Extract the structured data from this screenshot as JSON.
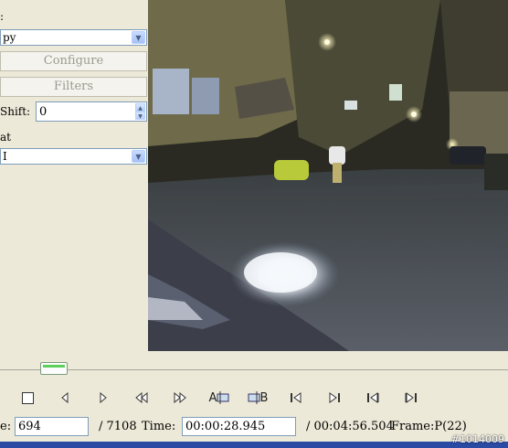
{
  "panel": {
    "video_label_fragment": ":",
    "video_codec": "py",
    "configure_button": "Configure",
    "filters_button": "Filters",
    "shift_label": "Shift:",
    "shift_value": "0",
    "format_label_fragment": "at",
    "format_value": "I"
  },
  "timeline": {
    "position_fraction": 0.098
  },
  "transport": {
    "ab_a_label": "A",
    "ab_b_label": "B"
  },
  "info": {
    "frame_label_fragment": "e:",
    "frame_value": "694",
    "frame_total": "/ 7108",
    "time_label": "Time:",
    "time_value": "00:00:28.945",
    "time_total": "/ 00:04:56.504",
    "frame_type": "Frame:P(22)"
  },
  "overlay": {
    "watermark": "#1014009"
  },
  "colors": {
    "window_bg": "#ece9d8",
    "statusbar": "#2b4aa3",
    "field_border": "#7f9db9"
  }
}
